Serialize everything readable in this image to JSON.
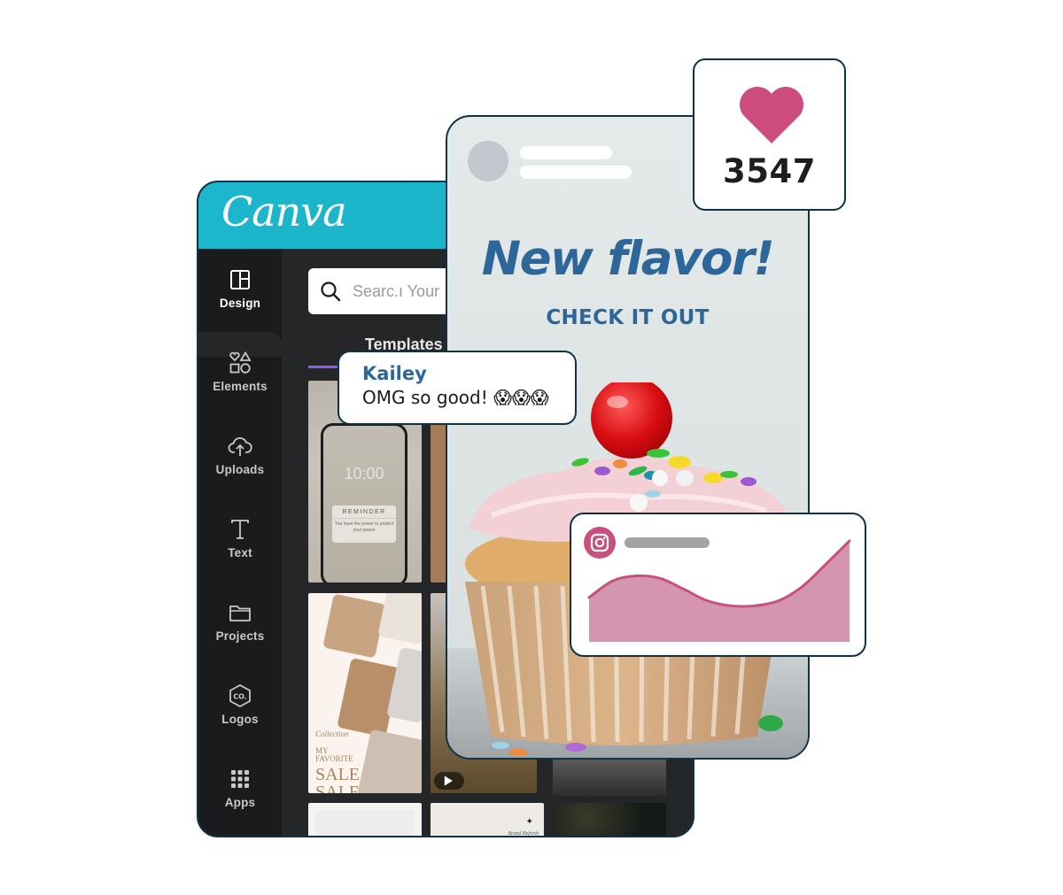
{
  "editor": {
    "logo": "Canva",
    "brand_color": "#1cb7cc",
    "sidebar": {
      "items": [
        {
          "label": "Design",
          "icon": "layout-icon",
          "active": true
        },
        {
          "label": "Elements",
          "icon": "shapes-icon",
          "active": false
        },
        {
          "label": "Uploads",
          "icon": "cloud-upload-icon",
          "active": false
        },
        {
          "label": "Text",
          "icon": "text-icon",
          "active": false
        },
        {
          "label": "Projects",
          "icon": "folder-icon",
          "active": false
        },
        {
          "label": "Logos",
          "icon": "logo-hexagon-icon",
          "active": false
        },
        {
          "label": "Apps",
          "icon": "grid-icon",
          "active": false
        }
      ]
    },
    "search": {
      "placeholder": "Search Your content",
      "visible_text": "Searc.ı Your"
    },
    "tabs": [
      {
        "label": "Templates",
        "active": true
      }
    ],
    "tab_accent": "#8b5cf6",
    "templates": [
      {
        "kind": "phone-reminder",
        "time": "10:00",
        "card_title": "REMINDER",
        "card_text": "You have the power to protect your peace"
      },
      {
        "kind": "photo-collage"
      },
      {
        "kind": "fashion-sale",
        "script": "Collection",
        "lines": [
          "MY",
          "FAVORITE"
        ],
        "big": [
          "SALE",
          "SALE"
        ]
      },
      {
        "kind": "video",
        "icon": "play-icon"
      },
      {
        "kind": "street-photo"
      },
      {
        "kind": "blank"
      },
      {
        "kind": "brand",
        "caption": "Brand Refresh"
      },
      {
        "kind": "bokeh"
      }
    ]
  },
  "post": {
    "headline": "New flavor!",
    "subline": "CHECK IT OUT",
    "text_color": "#2d6699"
  },
  "likes": {
    "icon": "heart-icon",
    "count": "3547",
    "color": "#cc4d7d"
  },
  "comment": {
    "author": "Kailey",
    "message": "OMG so good! 😱😱😱"
  },
  "insights": {
    "icon": "instagram-icon",
    "accent": "#c94f7c",
    "fill": "#d496ae",
    "trend": [
      0.32,
      0.52,
      0.58,
      0.55,
      0.42,
      0.28,
      0.22,
      0.22,
      0.28,
      0.45,
      0.72,
      1.0
    ]
  }
}
